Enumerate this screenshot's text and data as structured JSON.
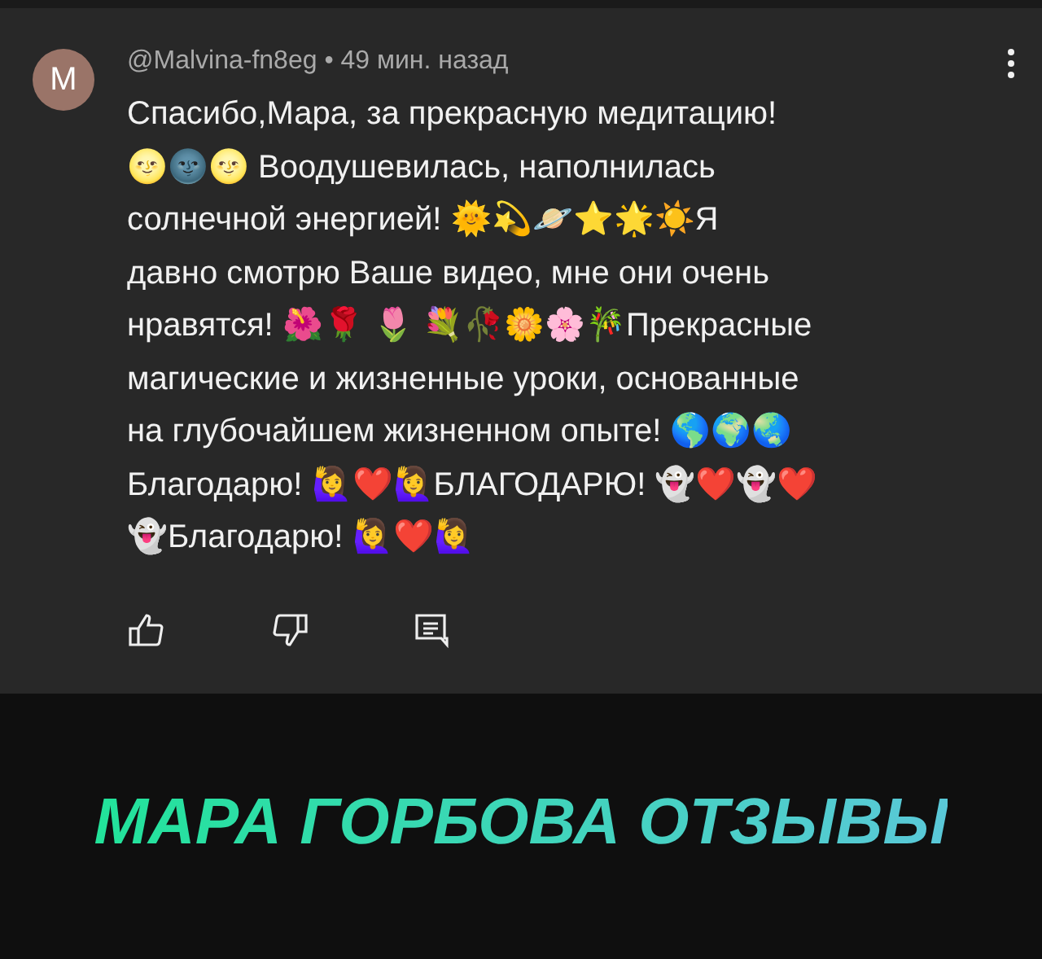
{
  "comment": {
    "avatar_letter": "M",
    "author": "@Malvina-fn8eg",
    "separator": "•",
    "time": "49 мин. назад",
    "lines": [
      "Спасибо,Мара, за прекрасную медитацию!",
      "🌝🌚🌝 Воодушевилась, наполнилась",
      "солнечной энергией! 🌞💫🪐⭐🌟☀️Я",
      "давно смотрю Ваше видео, мне они очень",
      "нравятся! 🌺🌹 🌷 💐🥀🌼🌸🎋Прекрасные",
      "магические и жизненные уроки, основанные",
      "на глубочайшем жизненном опыте! 🌎🌍🌏",
      "Благодарю! 🙋‍♀️❤️🙋‍♀️БЛАГОДАРЮ! 👻❤️👻❤️",
      "👻Благодарю! 🙋‍♀️❤️🙋‍♀️"
    ]
  },
  "banner": {
    "title": "МАРА ГОРБОВА ОТЗЫВЫ"
  }
}
